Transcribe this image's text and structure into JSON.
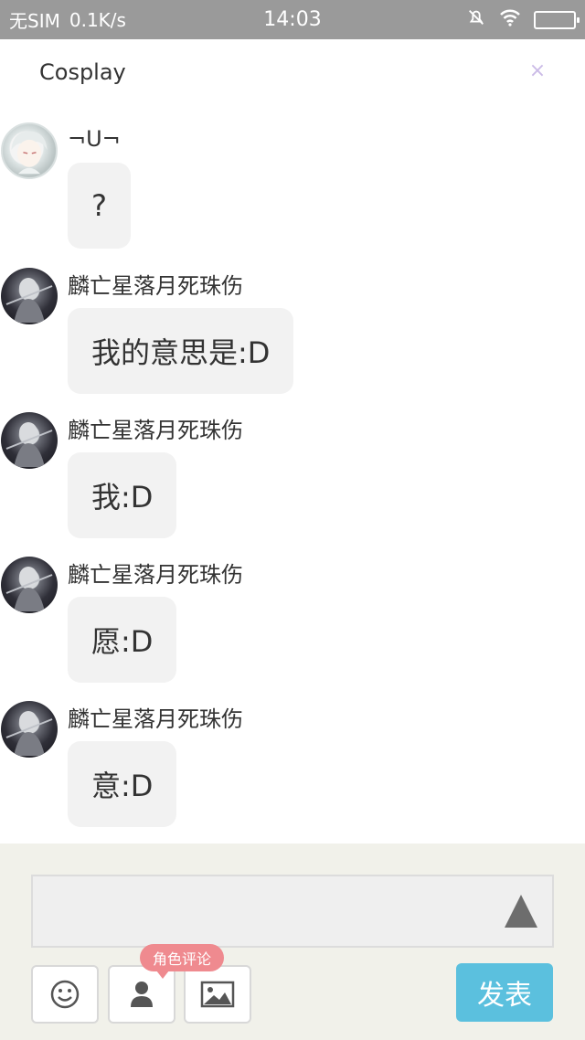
{
  "status_bar": {
    "carrier": "无SIM",
    "speed": "0.1K/s",
    "time": "14:03"
  },
  "header": {
    "title": "Cosplay",
    "close_label": "×"
  },
  "messages": [
    {
      "nickname": "¬U¬",
      "text": "?",
      "avatar": "light-haired-character-avatar"
    },
    {
      "nickname": "麟亡星落月死珠伤",
      "text": "我的意思是:D",
      "avatar": "dark-character-avatar"
    },
    {
      "nickname": "麟亡星落月死珠伤",
      "text": "我:D",
      "avatar": "dark-character-avatar"
    },
    {
      "nickname": "麟亡星落月死珠伤",
      "text": "愿:D",
      "avatar": "dark-character-avatar"
    },
    {
      "nickname": "麟亡星落月死珠伤",
      "text": "意:D",
      "avatar": "dark-character-avatar"
    }
  ],
  "composer": {
    "input_value": "",
    "tooltip": "角色评论",
    "post_label": "发表",
    "icons": [
      "emoji-icon",
      "role-icon",
      "image-icon",
      "send-triangle-icon"
    ]
  },
  "colors": {
    "accent": "#5bc0de",
    "tooltip": "#ef8a8f",
    "bubble": "#f2f2f2",
    "composer_bg": "#f1f1ea",
    "status_bar": "#9a9a9a"
  }
}
